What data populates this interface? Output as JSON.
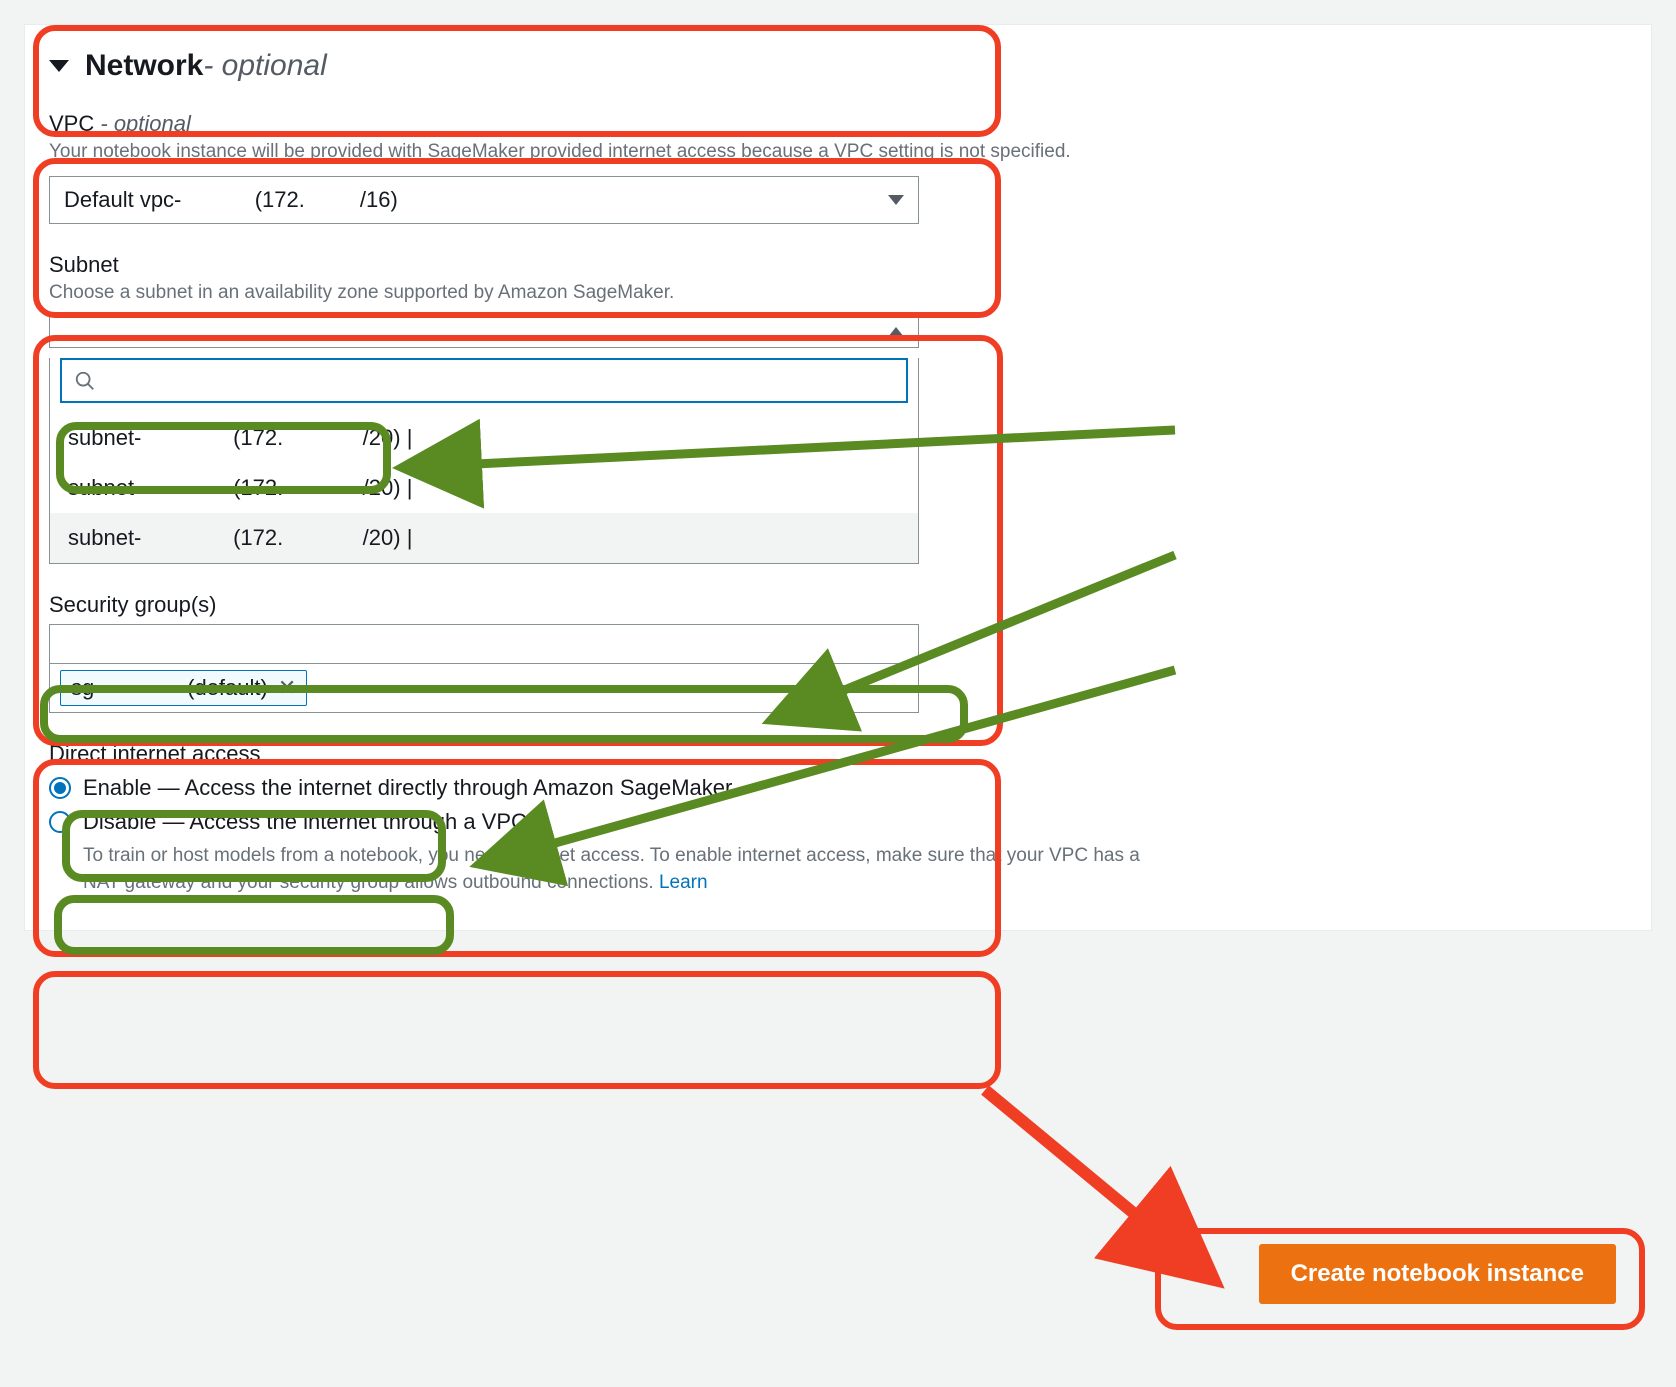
{
  "network": {
    "title": "Network",
    "optional": " - optional"
  },
  "vpc": {
    "label": "VPC",
    "optional": " - optional",
    "help": "Your notebook instance will be provided with SageMaker provided internet access because a VPC setting is not specified.",
    "value": "Default vpc-            (172.         /16)"
  },
  "subnet": {
    "label": "Subnet",
    "help": "Choose a subnet in an availability zone supported by Amazon SageMaker.",
    "value": "",
    "options": [
      "subnet-               (172.             /20) |",
      "subnet-               (172.             /20) |",
      "subnet-               (172.             /20) |"
    ]
  },
  "sg": {
    "label": "Security group(s)",
    "token": "sg-              (default)"
  },
  "dia": {
    "label": "Direct internet access",
    "enable": "Enable — Access the internet directly through Amazon SageMaker",
    "disable": "Disable — Access the internet through a VPC",
    "help": "To train or host models from a notebook, you need internet access. To enable internet access, make sure that your VPC has a NAT gateway and your security group allows outbound connections.  ",
    "learn": "Learn"
  },
  "create_btn": "Create notebook instance"
}
